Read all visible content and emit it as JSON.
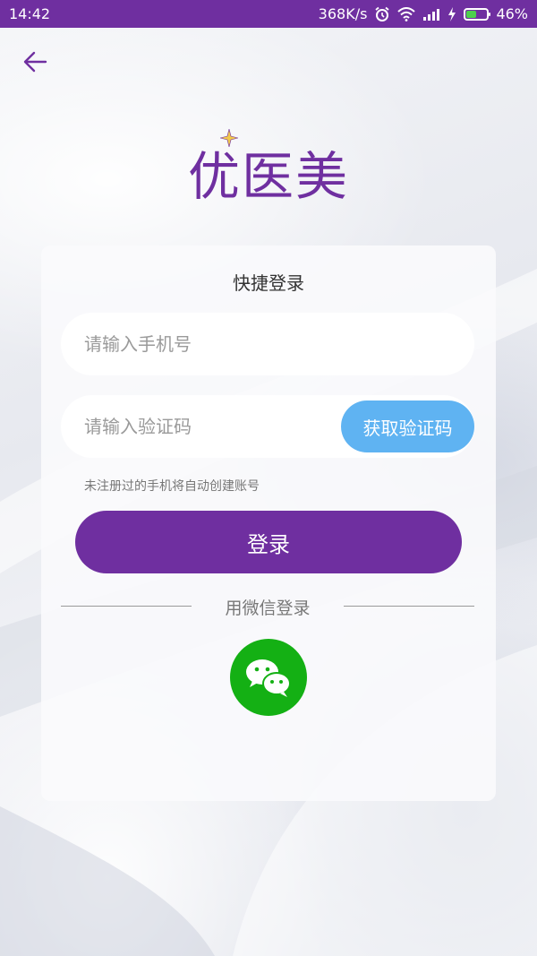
{
  "status_bar": {
    "time": "14:42",
    "network_speed": "368K/s",
    "battery_percent": "46%",
    "battery_level": 0.46
  },
  "logo": {
    "text": "优医美"
  },
  "card": {
    "title": "快捷登录",
    "phone_placeholder": "请输入手机号",
    "code_placeholder": "请输入验证码",
    "get_code_label": "获取验证码",
    "hint": "未注册过的手机将自动创建账号",
    "login_label": "登录",
    "wechat_label": "用微信登录"
  },
  "colors": {
    "brand": "#6f2fa0",
    "get_code_button": "#5fb3f2",
    "wechat_green": "#14b014"
  },
  "icons": [
    "back-arrow-icon",
    "alarm-icon",
    "wifi-icon",
    "signal-icon",
    "charging-icon",
    "battery-icon",
    "sparkle-star-icon",
    "wechat-icon"
  ]
}
